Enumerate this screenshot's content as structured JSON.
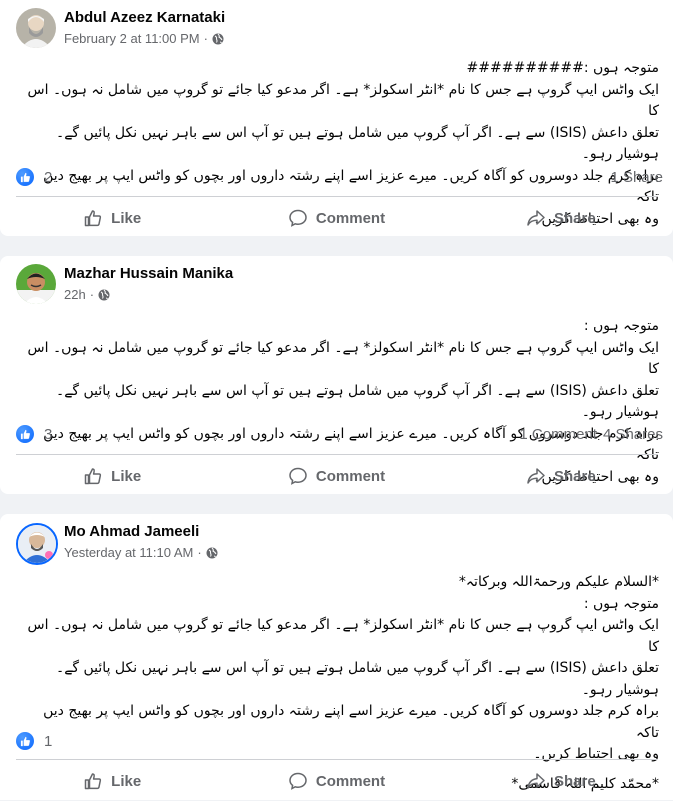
{
  "posts": [
    {
      "author": "Abdul Azeez Karnataki",
      "timestamp": "February 2 at 11:00 PM",
      "separator": "·",
      "body": [
        "متوجہ ہوں :##########",
        "ایک واٹس ایپ گروپ ہے جس کا نام *انٹر اسکولز* ہے۔ اگر مدعو کیا جائے تو گروپ میں شامل نہ ہوں۔ اس کا",
        "تعلق داعش (ISIS) سے ہے۔ اگر آپ گروپ میں شامل ہوتے ہیں تو آپ اس سے باہر نہیں نکل پائیں گے۔ ہوشیار رہو۔",
        "براہ کرم جلد دوسروں کو آگاہ کریں۔ میرے عزیز اسے اپنے رشتہ داروں اور بچوں کو واٹس ایپ پر بھیج دیں تاکہ",
        "وہ بھی احتیاط کریں۔"
      ],
      "reaction_count": "2",
      "comments_text": "",
      "shares_text": "1 Share"
    },
    {
      "author": "Mazhar Hussain Manika",
      "timestamp": "22h",
      "separator": "·",
      "body": [
        "متوجہ ہوں :",
        "ایک واٹس ایپ گروپ ہے جس کا نام *انٹر اسکولز* ہے۔ اگر مدعو کیا جائے تو گروپ میں شامل نہ ہوں۔ اس کا",
        "تعلق داعش (ISIS) سے ہے۔ اگر آپ گروپ میں شامل ہوتے ہیں تو آپ اس سے باہر نہیں نکل پائیں گے۔ ہوشیار رہو۔",
        "براہ کرم جلد دوسروں کو آگاہ کریں۔ میرے عزیز اسے اپنے رشتہ داروں اور بچوں کو واٹس ایپ پر بھیج دیں تاکہ",
        "وہ بھی احتیاط کریں۔"
      ],
      "reaction_count": "3",
      "comments_text": "1 Comment",
      "shares_text": "4 Shares"
    },
    {
      "author": "Mo Ahmad Jameeli",
      "timestamp": "Yesterday at 11:10 AM",
      "separator": "·",
      "body": [
        "*السلام علیکم ورحمۃاللہ وبرکاتہ*",
        "متوجہ ہوں :",
        "ایک واٹس ایپ گروپ ہے جس کا نام *انٹر اسکولز* ہے۔ اگر مدعو کیا جائے تو گروپ میں شامل نہ ہوں۔ اس کا",
        "تعلق داعش (ISIS) سے ہے۔ اگر آپ گروپ میں شامل ہوتے ہیں تو آپ اس سے باہر نہیں نکل پائیں گے۔ ہوشیار رہو۔",
        "براہ کرم جلد دوسروں کو آگاہ کریں۔ میرے عزیز اسے اپنے رشتہ داروں اور بچوں کو واٹس ایپ پر بھیج دیں تاکہ",
        "وہ بھی احتیاط کریں۔",
        "*محمّد کلیم اللہ قاسمی*"
      ],
      "reaction_count": "1",
      "comments_text": "",
      "shares_text": ""
    }
  ],
  "actions": {
    "like": "Like",
    "comment": "Comment",
    "share": "Share"
  },
  "icons": {
    "privacy": "globe-icon",
    "reaction": "thumbs-up-icon",
    "like": "thumbs-up-outline-icon",
    "comment": "comment-bubble-icon",
    "share": "share-arrow-icon"
  },
  "colors": {
    "accent": "#0866ff",
    "secondary_text": "#65676b",
    "divider": "#ced0d4",
    "background": "#f0f2f5"
  }
}
